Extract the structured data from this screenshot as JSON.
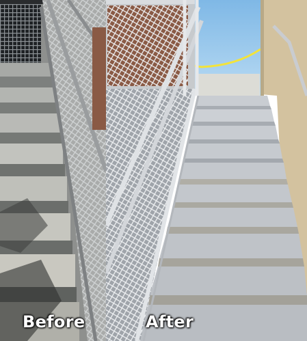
{
  "labels": {
    "before": "Before",
    "after": "After"
  },
  "colors": {
    "before_tone": "#9a9c9a",
    "after_tone": "#c9cdd2",
    "sky": "#8fc3ea",
    "caution_tape": "#f3e33a",
    "wall": "#d7c7a4"
  }
}
